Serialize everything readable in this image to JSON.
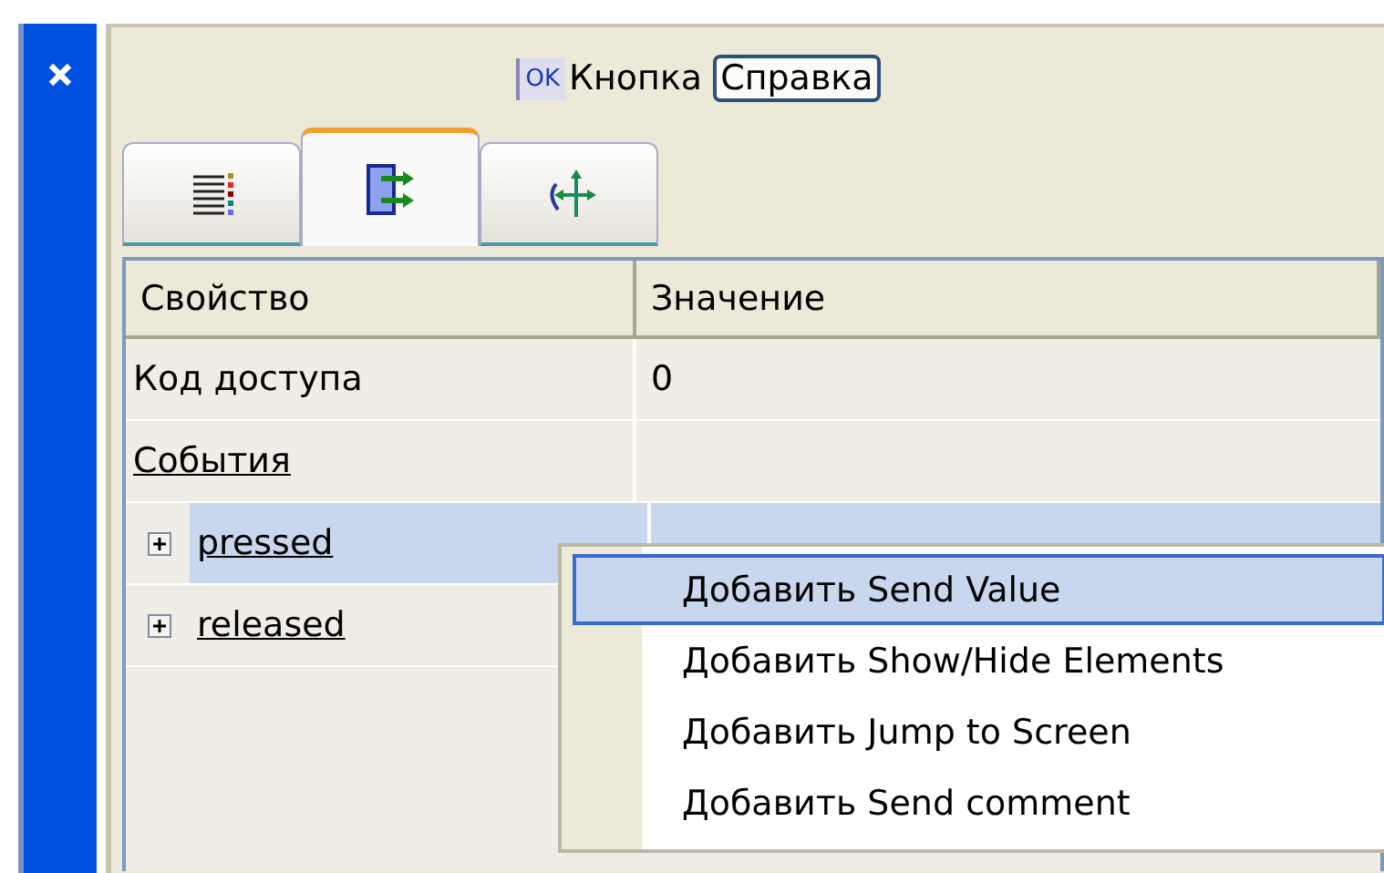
{
  "header": {
    "ok_icon": "OK",
    "title": "Кнопка",
    "help_button": "Справка"
  },
  "tabs": [
    {
      "kind": "list",
      "selected": false
    },
    {
      "kind": "events",
      "selected": true
    },
    {
      "kind": "move",
      "selected": false
    }
  ],
  "table": {
    "columns": [
      "Свойство",
      "Значение"
    ],
    "rows": [
      {
        "kind": "property",
        "name": "Код доступа",
        "value": "0"
      },
      {
        "kind": "group",
        "name": "События",
        "children": [
          {
            "name": "pressed",
            "expanded": false,
            "selected": true
          },
          {
            "name": "released",
            "expanded": false,
            "selected": false
          }
        ]
      }
    ]
  },
  "context_menu": {
    "items": [
      {
        "label": "Добавить Send Value",
        "selected": true
      },
      {
        "label": "Добавить Show/Hide Elements",
        "selected": false
      },
      {
        "label": "Добавить Jump to Screen",
        "selected": false
      },
      {
        "label": "Добавить Send comment",
        "selected": false
      }
    ]
  }
}
